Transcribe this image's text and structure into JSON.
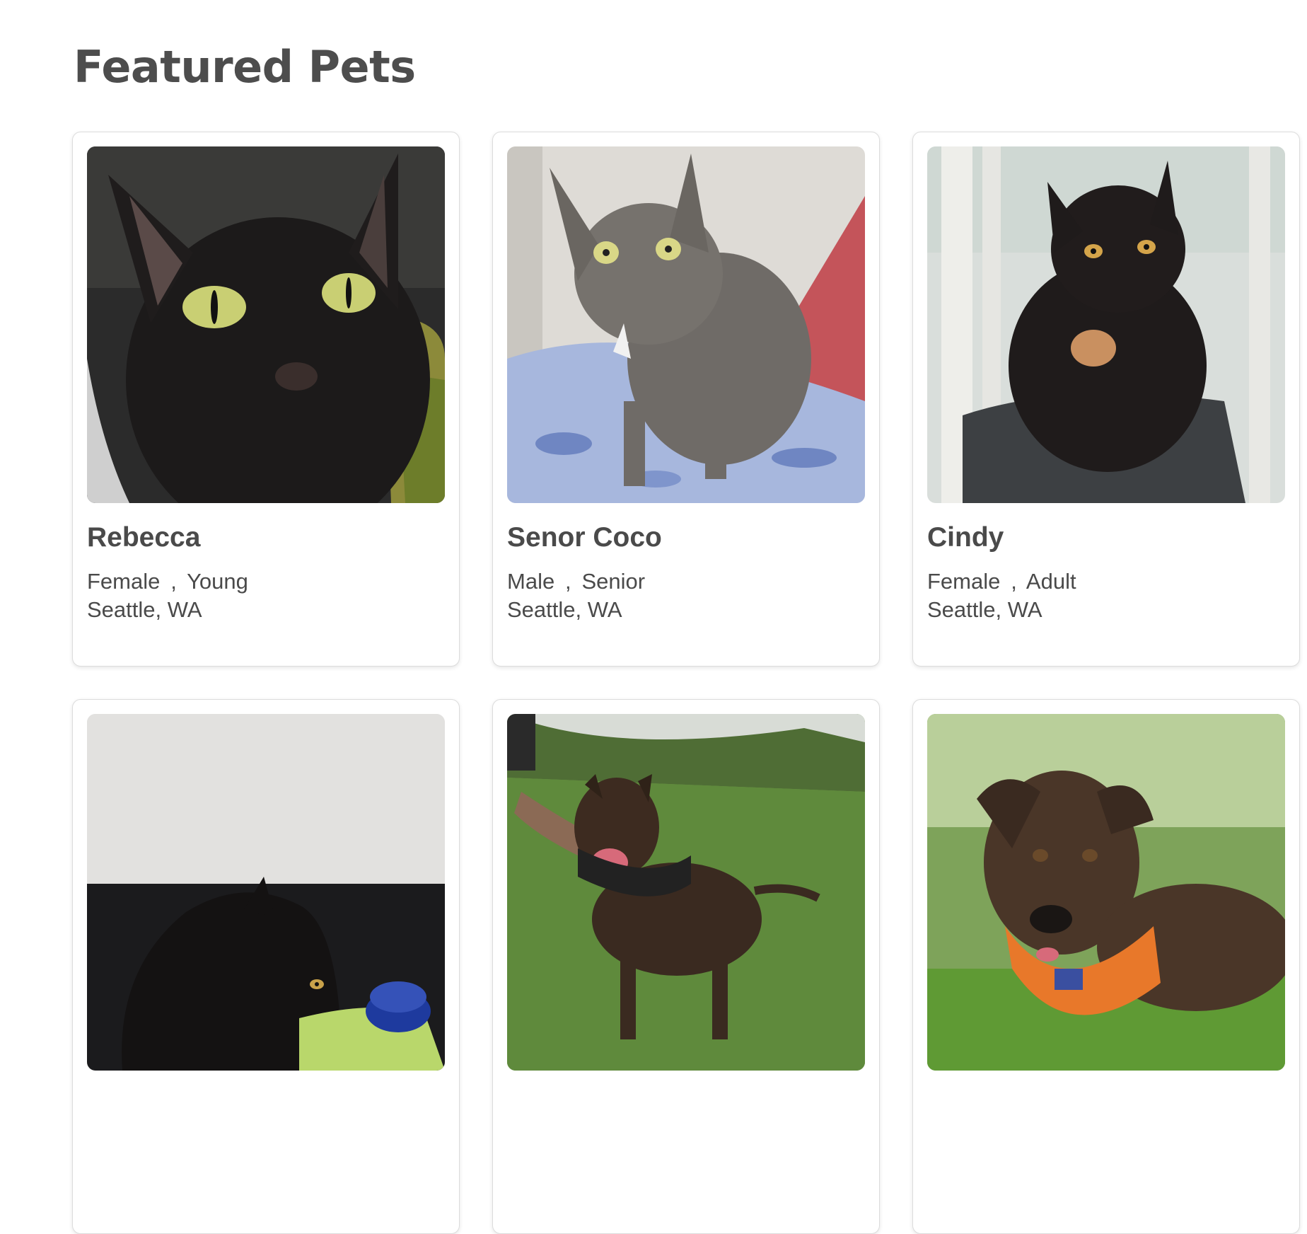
{
  "page": {
    "title": "Featured Pets"
  },
  "pets": [
    {
      "name": "Rebecca",
      "gender": "Female",
      "age": "Young",
      "location": "Seattle, WA",
      "photo_icon": "black-cat-photo"
    },
    {
      "name": "Senor Coco",
      "gender": "Male",
      "age": "Senior",
      "location": "Seattle, WA",
      "photo_icon": "gray-cat-photo"
    },
    {
      "name": "Cindy",
      "gender": "Female",
      "age": "Adult",
      "location": "Seattle, WA",
      "photo_icon": "tortoiseshell-cat-photo"
    },
    {
      "photo_icon": "black-cat-bowl-photo"
    },
    {
      "photo_icon": "brindle-dog-harness-photo"
    },
    {
      "photo_icon": "brindle-dog-bandana-photo"
    }
  ],
  "separator": ",",
  "colors": {
    "text": "#4a4a4a",
    "card_border": "#dcdcdc",
    "background": "#ffffff"
  }
}
